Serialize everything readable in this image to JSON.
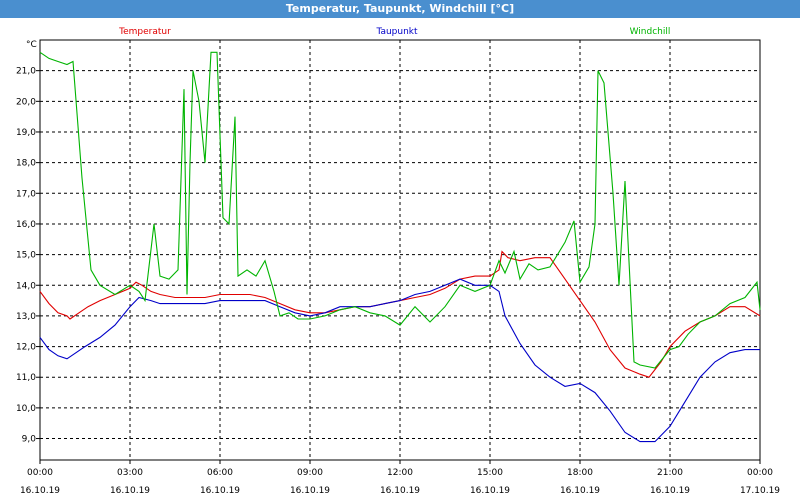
{
  "window": {
    "title": "Temperatur, Taupunkt, Windchill [°C]"
  },
  "chart_data": {
    "type": "line",
    "title": "Temperatur, Taupunkt, Windchill [°C]",
    "ylabel": "°C",
    "xlabel": "",
    "ylim": [
      8.3,
      22.0
    ],
    "yticks": [
      9.0,
      10.0,
      11.0,
      12.0,
      13.0,
      14.0,
      15.0,
      16.0,
      17.0,
      18.0,
      19.0,
      20.0,
      21.0
    ],
    "ytick_labels": [
      "9,0",
      "10,0",
      "11,0",
      "12,0",
      "13,0",
      "14,0",
      "15,0",
      "16,0",
      "17,0",
      "18,0",
      "19,0",
      "20,0",
      "21,0"
    ],
    "xlim": [
      0,
      24
    ],
    "xticks": [
      0,
      3,
      6,
      9,
      12,
      15,
      18,
      21,
      24
    ],
    "xtick_labels": [
      {
        "time": "00:00",
        "date": "16.10.19"
      },
      {
        "time": "03:00",
        "date": "16.10.19"
      },
      {
        "time": "06:00",
        "date": "16.10.19"
      },
      {
        "time": "09:00",
        "date": "16.10.19"
      },
      {
        "time": "12:00",
        "date": "16.10.19"
      },
      {
        "time": "15:00",
        "date": "16.10.19"
      },
      {
        "time": "18:00",
        "date": "16.10.19"
      },
      {
        "time": "21:00",
        "date": "16.10.19"
      },
      {
        "time": "00:00",
        "date": "17.10.19"
      }
    ],
    "grid": true,
    "legend_position": "top",
    "series": [
      {
        "name": "Temperatur",
        "color": "#e00000",
        "points": [
          [
            0,
            13.8
          ],
          [
            0.3,
            13.4
          ],
          [
            0.6,
            13.1
          ],
          [
            0.9,
            13.0
          ],
          [
            1.0,
            12.9
          ],
          [
            1.3,
            13.1
          ],
          [
            1.6,
            13.3
          ],
          [
            2.0,
            13.5
          ],
          [
            2.5,
            13.7
          ],
          [
            3.0,
            13.9
          ],
          [
            3.2,
            14.1
          ],
          [
            3.4,
            14.0
          ],
          [
            3.7,
            13.8
          ],
          [
            4.0,
            13.7
          ],
          [
            4.5,
            13.6
          ],
          [
            5.0,
            13.6
          ],
          [
            5.5,
            13.6
          ],
          [
            6.0,
            13.7
          ],
          [
            6.5,
            13.7
          ],
          [
            7.0,
            13.7
          ],
          [
            7.5,
            13.6
          ],
          [
            8.0,
            13.4
          ],
          [
            8.5,
            13.2
          ],
          [
            9.0,
            13.1
          ],
          [
            9.5,
            13.1
          ],
          [
            10.0,
            13.2
          ],
          [
            10.5,
            13.3
          ],
          [
            11.0,
            13.3
          ],
          [
            11.5,
            13.4
          ],
          [
            12.0,
            13.5
          ],
          [
            12.5,
            13.6
          ],
          [
            13.0,
            13.7
          ],
          [
            13.5,
            13.9
          ],
          [
            14.0,
            14.2
          ],
          [
            14.5,
            14.3
          ],
          [
            15.0,
            14.3
          ],
          [
            15.3,
            14.5
          ],
          [
            15.4,
            15.1
          ],
          [
            15.6,
            14.9
          ],
          [
            16.0,
            14.8
          ],
          [
            16.5,
            14.9
          ],
          [
            17.0,
            14.9
          ],
          [
            17.5,
            14.2
          ],
          [
            18.0,
            13.5
          ],
          [
            18.5,
            12.8
          ],
          [
            19.0,
            11.9
          ],
          [
            19.5,
            11.3
          ],
          [
            20.0,
            11.1
          ],
          [
            20.3,
            11.0
          ],
          [
            20.7,
            11.5
          ],
          [
            21.0,
            12.0
          ],
          [
            21.5,
            12.5
          ],
          [
            22.0,
            12.8
          ],
          [
            22.5,
            13.0
          ],
          [
            23.0,
            13.3
          ],
          [
            23.5,
            13.3
          ],
          [
            24.0,
            13.0
          ]
        ]
      },
      {
        "name": "Taupunkt",
        "color": "#0000c8",
        "points": [
          [
            0,
            12.3
          ],
          [
            0.3,
            11.9
          ],
          [
            0.6,
            11.7
          ],
          [
            0.9,
            11.6
          ],
          [
            1.2,
            11.8
          ],
          [
            1.5,
            12.0
          ],
          [
            2.0,
            12.3
          ],
          [
            2.5,
            12.7
          ],
          [
            3.0,
            13.3
          ],
          [
            3.3,
            13.6
          ],
          [
            3.7,
            13.5
          ],
          [
            4.0,
            13.4
          ],
          [
            4.5,
            13.4
          ],
          [
            5.0,
            13.4
          ],
          [
            5.5,
            13.4
          ],
          [
            6.0,
            13.5
          ],
          [
            6.5,
            13.5
          ],
          [
            7.0,
            13.5
          ],
          [
            7.5,
            13.5
          ],
          [
            8.0,
            13.3
          ],
          [
            8.5,
            13.1
          ],
          [
            9.0,
            13.0
          ],
          [
            9.5,
            13.1
          ],
          [
            10.0,
            13.3
          ],
          [
            10.5,
            13.3
          ],
          [
            11.0,
            13.3
          ],
          [
            11.5,
            13.4
          ],
          [
            12.0,
            13.5
          ],
          [
            12.5,
            13.7
          ],
          [
            13.0,
            13.8
          ],
          [
            13.5,
            14.0
          ],
          [
            14.0,
            14.2
          ],
          [
            14.5,
            14.0
          ],
          [
            15.0,
            14.0
          ],
          [
            15.3,
            13.8
          ],
          [
            15.5,
            13.0
          ],
          [
            16.0,
            12.1
          ],
          [
            16.5,
            11.4
          ],
          [
            17.0,
            11.0
          ],
          [
            17.5,
            10.7
          ],
          [
            18.0,
            10.8
          ],
          [
            18.5,
            10.5
          ],
          [
            19.0,
            9.9
          ],
          [
            19.5,
            9.2
          ],
          [
            20.0,
            8.9
          ],
          [
            20.5,
            8.9
          ],
          [
            21.0,
            9.4
          ],
          [
            21.5,
            10.2
          ],
          [
            22.0,
            11.0
          ],
          [
            22.5,
            11.5
          ],
          [
            23.0,
            11.8
          ],
          [
            23.5,
            11.9
          ],
          [
            24.0,
            11.9
          ]
        ]
      },
      {
        "name": "Windchill",
        "color": "#00b400",
        "points": [
          [
            0,
            21.6
          ],
          [
            0.3,
            21.4
          ],
          [
            0.6,
            21.3
          ],
          [
            0.9,
            21.2
          ],
          [
            1.1,
            21.3
          ],
          [
            1.4,
            17.5
          ],
          [
            1.7,
            14.5
          ],
          [
            2.0,
            14.0
          ],
          [
            2.5,
            13.7
          ],
          [
            3.0,
            14.0
          ],
          [
            3.3,
            13.8
          ],
          [
            3.5,
            13.5
          ],
          [
            3.8,
            16.0
          ],
          [
            4.0,
            14.3
          ],
          [
            4.3,
            14.2
          ],
          [
            4.6,
            14.5
          ],
          [
            4.8,
            20.4
          ],
          [
            4.9,
            13.7
          ],
          [
            5.0,
            18.0
          ],
          [
            5.1,
            21.0
          ],
          [
            5.3,
            20.0
          ],
          [
            5.5,
            18.0
          ],
          [
            5.7,
            21.6
          ],
          [
            5.9,
            21.6
          ],
          [
            6.1,
            16.2
          ],
          [
            6.3,
            16.0
          ],
          [
            6.5,
            19.5
          ],
          [
            6.6,
            14.3
          ],
          [
            6.9,
            14.5
          ],
          [
            7.2,
            14.3
          ],
          [
            7.5,
            14.8
          ],
          [
            7.8,
            13.8
          ],
          [
            8.0,
            13.0
          ],
          [
            8.3,
            13.1
          ],
          [
            8.6,
            12.9
          ],
          [
            9.0,
            12.9
          ],
          [
            9.5,
            13.0
          ],
          [
            10.0,
            13.2
          ],
          [
            10.5,
            13.3
          ],
          [
            11.0,
            13.1
          ],
          [
            11.5,
            13.0
          ],
          [
            12.0,
            12.7
          ],
          [
            12.5,
            13.3
          ],
          [
            13.0,
            12.8
          ],
          [
            13.5,
            13.3
          ],
          [
            14.0,
            14.0
          ],
          [
            14.5,
            13.8
          ],
          [
            15.0,
            14.0
          ],
          [
            15.3,
            14.8
          ],
          [
            15.5,
            14.4
          ],
          [
            15.8,
            15.1
          ],
          [
            16.0,
            14.2
          ],
          [
            16.3,
            14.7
          ],
          [
            16.6,
            14.5
          ],
          [
            17.0,
            14.6
          ],
          [
            17.5,
            15.4
          ],
          [
            17.8,
            16.1
          ],
          [
            18.0,
            14.1
          ],
          [
            18.3,
            14.6
          ],
          [
            18.5,
            16.0
          ],
          [
            18.6,
            21.0
          ],
          [
            18.8,
            20.6
          ],
          [
            19.1,
            17.0
          ],
          [
            19.3,
            14.0
          ],
          [
            19.5,
            17.4
          ],
          [
            19.8,
            11.5
          ],
          [
            20.0,
            11.4
          ],
          [
            20.5,
            11.3
          ],
          [
            21.0,
            11.9
          ],
          [
            21.3,
            12.0
          ],
          [
            21.6,
            12.4
          ],
          [
            22.0,
            12.8
          ],
          [
            22.5,
            13.0
          ],
          [
            23.0,
            13.4
          ],
          [
            23.5,
            13.6
          ],
          [
            23.9,
            14.1
          ],
          [
            24.0,
            13.2
          ]
        ]
      }
    ]
  }
}
